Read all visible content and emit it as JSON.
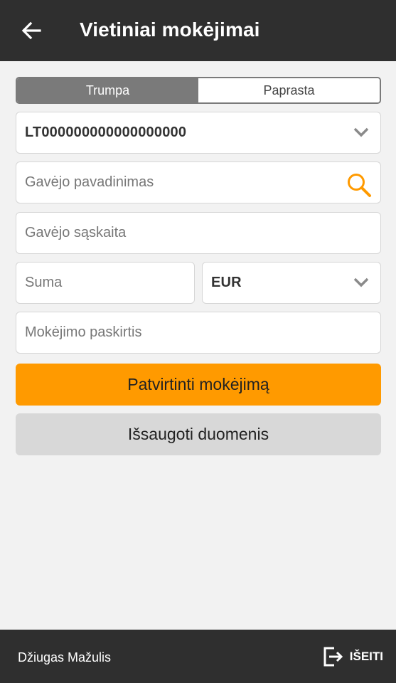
{
  "header": {
    "title": "Vietiniai mokėjimai",
    "back_icon": "arrow-left-icon"
  },
  "mode_toggle": {
    "options": [
      {
        "label": "Trumpa",
        "selected": true
      },
      {
        "label": "Paprasta",
        "selected": false
      }
    ]
  },
  "form": {
    "source_account": {
      "value": "LT000000000000000000",
      "icon": "chevron-down-icon"
    },
    "recipient_name": {
      "placeholder": "Gavėjo pavadinimas",
      "icon": "search-icon"
    },
    "recipient_account": {
      "placeholder": "Gavėjo sąskaita"
    },
    "amount": {
      "placeholder": "Suma"
    },
    "currency": {
      "value": "EUR",
      "icon": "chevron-down-icon"
    },
    "purpose": {
      "placeholder": "Mokėjimo paskirtis"
    }
  },
  "actions": {
    "confirm_label": "Patvirtinti mokėjimą",
    "save_label": "Išsaugoti duomenis"
  },
  "footer": {
    "user_name": "Džiugas Mažulis",
    "logout_label": "IŠEITI",
    "logout_icon": "logout-icon"
  },
  "colors": {
    "header_bg": "#2f2f2f",
    "accent": "#ff9a00",
    "toggle_active": "#7a7a7a",
    "secondary_button": "#d8d8d8",
    "background": "#f2f2f2"
  }
}
